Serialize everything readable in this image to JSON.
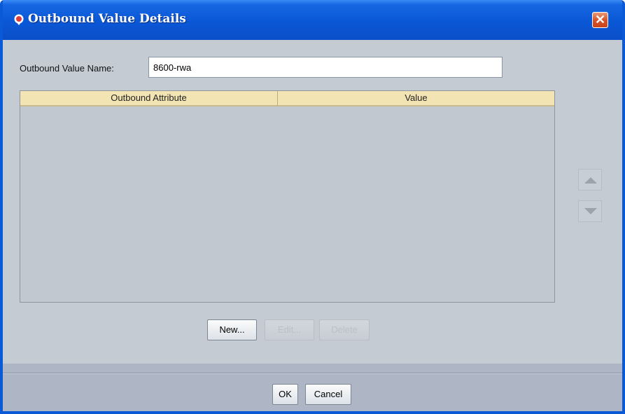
{
  "window": {
    "title": "Outbound Value Details",
    "close_glyph": "✕"
  },
  "form": {
    "name_label": "Outbound Value Name:",
    "name_value": "8600-rwa"
  },
  "table": {
    "columns": [
      "Outbound Attribute",
      "Value"
    ],
    "rows": []
  },
  "actions": {
    "new_label": "New...",
    "edit_label": "Edit...",
    "delete_label": "Delete"
  },
  "footer": {
    "ok_label": "OK",
    "cancel_label": "Cancel"
  },
  "icons": {
    "title_icon": "app-icon",
    "move_up": "move-up-icon",
    "move_down": "move-down-icon"
  },
  "colors": {
    "titlebar": "#0a57d6",
    "header": "#f3e4b4",
    "close": "#d7542a"
  }
}
